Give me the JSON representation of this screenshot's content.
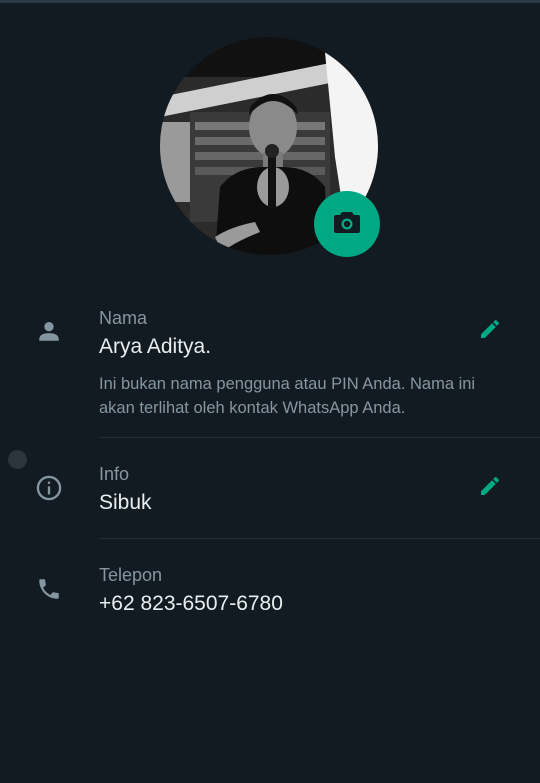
{
  "colors": {
    "background": "#121b22",
    "accent": "#00a884",
    "label": "#8696a0",
    "text": "#e9edef"
  },
  "profile": {
    "photo_icon": "profile-photo",
    "camera_icon": "camera-icon"
  },
  "name": {
    "label": "Nama",
    "value": "Arya Aditya.",
    "hint": "Ini bukan nama pengguna atau PIN Anda. Nama ini akan terlihat oleh kontak WhatsApp Anda.",
    "icon": "person-icon",
    "edit_icon": "pencil-icon"
  },
  "about": {
    "label": "Info",
    "value": "Sibuk",
    "icon": "info-icon",
    "edit_icon": "pencil-icon"
  },
  "phone": {
    "label": "Telepon",
    "value": "+62 823-6507-6780",
    "icon": "phone-icon"
  }
}
